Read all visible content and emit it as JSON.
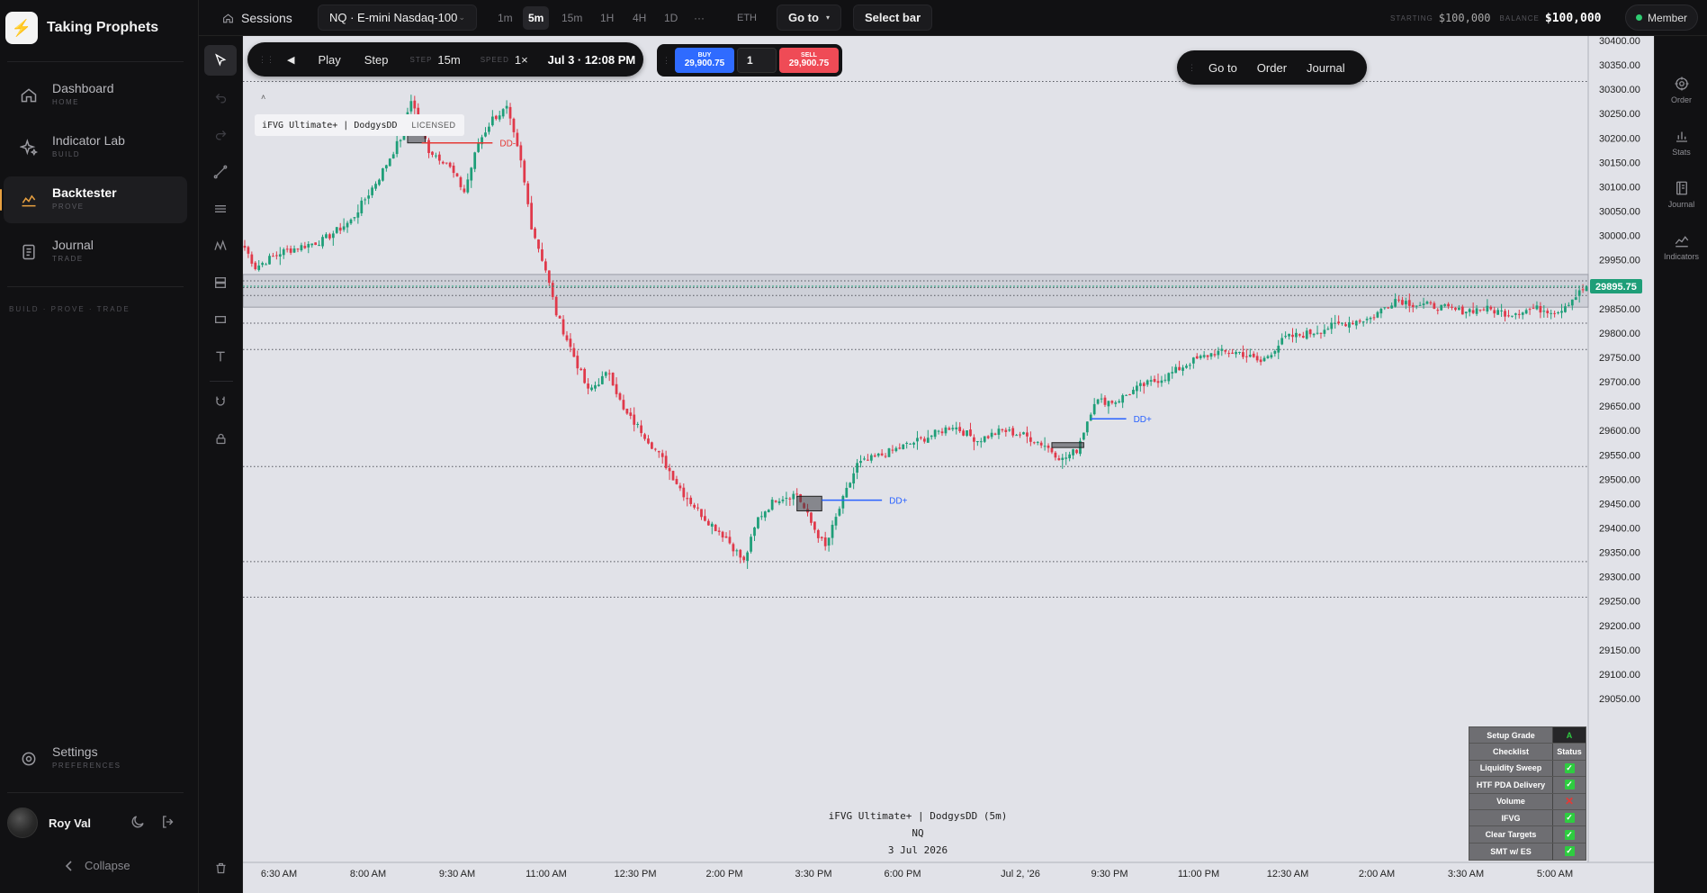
{
  "sidebar": {
    "brand": "Taking Prophets",
    "nav": [
      {
        "label": "Dashboard",
        "sub": "HOME",
        "icon": "home-icon"
      },
      {
        "label": "Indicator Lab",
        "sub": "BUILD",
        "icon": "sparkle-icon"
      },
      {
        "label": "Backtester",
        "sub": "PROVE",
        "icon": "chart-icon"
      },
      {
        "label": "Journal",
        "sub": "TRADE",
        "icon": "journal-icon"
      }
    ],
    "tagline": "BUILD · PROVE · TRADE",
    "settings": {
      "label": "Settings",
      "sub": "PREFERENCES"
    },
    "user": "Roy Val",
    "collapse": "Collapse"
  },
  "topbar": {
    "sessions": "Sessions",
    "symbol": "NQ · E-mini Nasdaq-100",
    "timeframes": [
      "1m",
      "5m",
      "15m",
      "1H",
      "4H",
      "1D",
      "···"
    ],
    "active_timeframe": "5m",
    "eth": "ETH",
    "goto": "Go to",
    "select_bar": "Select bar",
    "starting_caption": "STARTING",
    "starting_value": "$100,000",
    "balance_caption": "BALANCE",
    "balance_value": "$100,000",
    "member": "Member"
  },
  "playback": {
    "play": "Play",
    "step": "Step",
    "step_caption": "STEP",
    "step_value": "15m",
    "speed_caption": "SPEED",
    "speed_value": "1×",
    "datetime": "Jul 3 · 12:08 PM"
  },
  "trade": {
    "buy_label": "BUY",
    "buy_price": "29,900.75",
    "qty": "1",
    "sell_label": "SELL",
    "sell_price": "29,900.75"
  },
  "quicknav": {
    "goto": "Go to",
    "order": "Order",
    "journal": "Journal"
  },
  "rail": [
    {
      "label": "Order",
      "icon": "target-icon"
    },
    {
      "label": "Stats",
      "icon": "bar-chart-icon"
    },
    {
      "label": "Journal",
      "icon": "book-icon"
    },
    {
      "label": "Indicators",
      "icon": "indicator-icon"
    }
  ],
  "indicator": {
    "name": "iFVG Ultimate+ | DodgysDD",
    "tag": "LICENSED"
  },
  "watermark": {
    "line1": "iFVG Ultimate+ | DodgysDD (5m)",
    "line2": "NQ",
    "line3": "3 Jul 2026"
  },
  "checklist": {
    "grade_label": "Setup Grade",
    "grade_value": "A",
    "header_left": "Checklist",
    "header_right": "Status",
    "items": [
      {
        "name": "Liquidity Sweep",
        "ok": true
      },
      {
        "name": "HTF PDA Delivery",
        "ok": true
      },
      {
        "name": "Volume",
        "ok": false
      },
      {
        "name": "IFVG",
        "ok": true
      },
      {
        "name": "Clear Targets",
        "ok": true
      },
      {
        "name": "SMT w/ ES",
        "ok": true
      }
    ]
  },
  "chart_data": {
    "type": "candlestick",
    "symbol": "NQ",
    "y_ticks": [
      30400,
      30350,
      30300,
      30250,
      30200,
      30150,
      30100,
      30050,
      30000,
      29950,
      29900,
      29850,
      29800,
      29750,
      29700,
      29650,
      29600,
      29550,
      29500,
      29450,
      29400,
      29350,
      29300,
      29250,
      29200,
      29150,
      29100,
      29050
    ],
    "y_tick_labels": [
      "30400.00",
      "30350.00",
      "30300.00",
      "30250.00",
      "30200.00",
      "30150.00",
      "30100.00",
      "30050.00",
      "30000.00",
      "29950.00",
      "29900.00",
      "29850.00",
      "29800.00",
      "29750.00",
      "29700.00",
      "29650.00",
      "29600.00",
      "29550.00",
      "29500.00",
      "29450.00",
      "29400.00",
      "29350.00",
      "29300.00",
      "29250.00",
      "29200.00",
      "29150.00",
      "29100.00",
      "29050.00"
    ],
    "ylim": [
      29020,
      30410
    ],
    "x_tick_labels": [
      "6:30 AM",
      "8:00 AM",
      "9:30 AM",
      "11:00 AM",
      "12:30 PM",
      "2:00 PM",
      "3:30 PM",
      "6:00 PM",
      "Jul 2, '26",
      "9:30 PM",
      "11:00 PM",
      "12:30 AM",
      "2:00 AM",
      "3:30 AM",
      "5:00 AM"
    ],
    "last_price": "29895.75",
    "last_price_value": 29895.75,
    "anchors": [
      [
        0,
        29975
      ],
      [
        3,
        29935
      ],
      [
        10,
        29965
      ],
      [
        22,
        29990
      ],
      [
        30,
        30030
      ],
      [
        38,
        30120
      ],
      [
        44,
        30200
      ],
      [
        47,
        30280
      ],
      [
        52,
        30175
      ],
      [
        57,
        30150
      ],
      [
        62,
        30090
      ],
      [
        66,
        30190
      ],
      [
        70,
        30240
      ],
      [
        74,
        30260
      ],
      [
        78,
        30150
      ],
      [
        81,
        30020
      ],
      [
        85,
        29930
      ],
      [
        88,
        29840
      ],
      [
        92,
        29770
      ],
      [
        97,
        29680
      ],
      [
        103,
        29720
      ],
      [
        107,
        29640
      ],
      [
        112,
        29600
      ],
      [
        118,
        29540
      ],
      [
        124,
        29470
      ],
      [
        130,
        29420
      ],
      [
        136,
        29380
      ],
      [
        141,
        29330
      ],
      [
        145,
        29420
      ],
      [
        150,
        29460
      ],
      [
        156,
        29470
      ],
      [
        160,
        29410
      ],
      [
        164,
        29360
      ],
      [
        168,
        29440
      ],
      [
        173,
        29530
      ],
      [
        180,
        29550
      ],
      [
        187,
        29570
      ],
      [
        194,
        29590
      ],
      [
        200,
        29610
      ],
      [
        207,
        29580
      ],
      [
        214,
        29600
      ],
      [
        220,
        29590
      ],
      [
        226,
        29570
      ],
      [
        231,
        29540
      ],
      [
        235,
        29560
      ],
      [
        240,
        29660
      ],
      [
        246,
        29660
      ],
      [
        253,
        29690
      ],
      [
        260,
        29710
      ],
      [
        267,
        29740
      ],
      [
        274,
        29760
      ],
      [
        281,
        29760
      ],
      [
        287,
        29740
      ],
      [
        294,
        29790
      ],
      [
        301,
        29800
      ],
      [
        310,
        29820
      ],
      [
        318,
        29830
      ],
      [
        325,
        29870
      ],
      [
        330,
        29860
      ],
      [
        336,
        29855
      ],
      [
        343,
        29845
      ],
      [
        350,
        29850
      ],
      [
        357,
        29840
      ],
      [
        364,
        29850
      ],
      [
        371,
        29845
      ],
      [
        375,
        29870
      ],
      [
        379,
        29895
      ]
    ],
    "bar_count": 380,
    "levels": [
      30316,
      29907,
      29893,
      29877,
      29820,
      29766,
      29526,
      29331,
      29258
    ],
    "zones": [
      {
        "top": 29920,
        "bottom": 29853
      }
    ],
    "fvg_boxes": [
      {
        "start": 46,
        "end": 51,
        "top": 30235,
        "bottom": 30190
      },
      {
        "start": 156,
        "end": 163,
        "top": 29465,
        "bottom": 29435
      },
      {
        "start": 228,
        "end": 237,
        "top": 29575,
        "bottom": 29565
      }
    ],
    "annotations": [
      {
        "label": "DD-",
        "bar": 70,
        "price": 30190,
        "start": 50,
        "color": "#e53935"
      },
      {
        "label": "DD+",
        "bar": 180,
        "price": 29457,
        "start": 163,
        "color": "#2962ff"
      },
      {
        "label": "DD+",
        "bar": 249,
        "price": 29624,
        "start": 239,
        "color": "#2962ff"
      }
    ]
  }
}
